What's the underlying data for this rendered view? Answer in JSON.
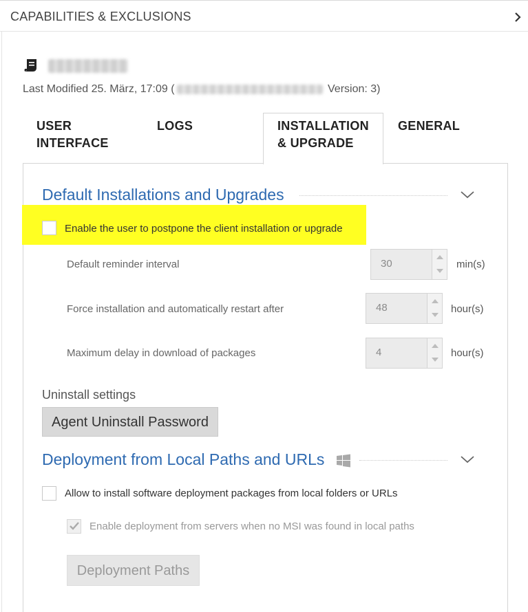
{
  "header": {
    "title": "CAPABILITIES & EXCLUSIONS"
  },
  "document": {
    "last_modified_prefix": "Last Modified 25. März, 17:09 (",
    "last_modified_suffix": " Version: 3)"
  },
  "tabs": [
    {
      "line1": "USER",
      "line2": "INTERFACE",
      "active": false
    },
    {
      "line1": "LOGS",
      "line2": "",
      "active": false
    },
    {
      "line1": "INSTALLATION",
      "line2": "& UPGRADE",
      "active": true
    },
    {
      "line1": "GENERAL",
      "line2": "",
      "active": false
    }
  ],
  "section_install": {
    "title": "Default Installations and Upgrades",
    "postpone_label": "Enable the user to postpone the client installation or upgrade",
    "postpone_checked": false,
    "fields": [
      {
        "label": "Default reminder interval",
        "value": "30",
        "unit": "min(s)"
      },
      {
        "label": "Force installation and automatically restart after",
        "value": "48",
        "unit": "hour(s)"
      },
      {
        "label": "Maximum delay in download of packages",
        "value": "4",
        "unit": "hour(s)"
      }
    ]
  },
  "uninstall": {
    "heading": "Uninstall settings",
    "button_label": "Agent Uninstall Password"
  },
  "section_deploy": {
    "title": "Deployment from Local Paths and URLs",
    "allow_label": "Allow to install software deployment packages from local folders or URLs",
    "allow_checked": false,
    "servers_label": "Enable deployment from servers when no MSI was found in local paths",
    "servers_checked": true,
    "paths_button_label": "Deployment Paths"
  },
  "colors": {
    "accent": "#2e6ab1",
    "highlight": "#ffff22"
  }
}
